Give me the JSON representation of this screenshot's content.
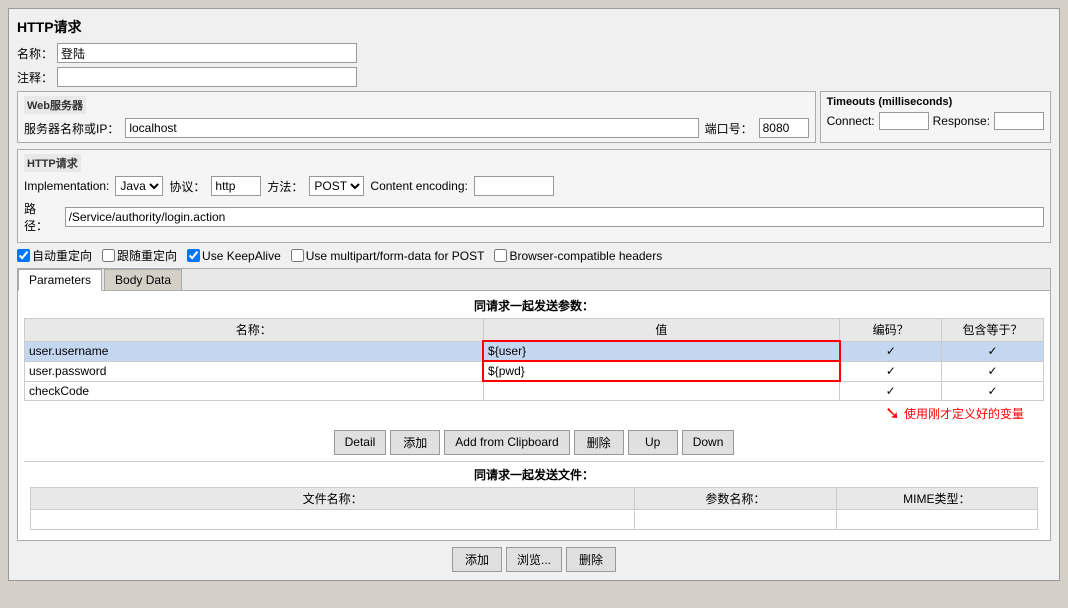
{
  "page": {
    "title": "HTTP请求"
  },
  "form": {
    "name_label": "名称：",
    "name_value": "登陆",
    "comment_label": "注释：",
    "comment_value": ""
  },
  "web_server": {
    "section_label": "Web服务器",
    "server_label": "服务器名称或IP：",
    "server_value": "localhost",
    "port_label": "端口号：",
    "port_value": "8080"
  },
  "timeouts": {
    "section_label": "Timeouts (milliseconds)",
    "connect_label": "Connect:",
    "connect_value": "",
    "response_label": "Response:",
    "response_value": ""
  },
  "http_section": {
    "section_label": "HTTP请求",
    "impl_label": "Implementation:",
    "impl_value": "Java",
    "protocol_label": "协议：",
    "protocol_value": "http",
    "method_label": "方法：",
    "method_value": "POST",
    "encoding_label": "Content encoding:",
    "encoding_value": "",
    "path_label": "路径：",
    "path_value": "/Service/authority/login.action"
  },
  "checkboxes": {
    "auto_redirect_label": "自动重定向",
    "auto_redirect_checked": true,
    "follow_redirect_label": "跟随重定向",
    "follow_redirect_checked": false,
    "keepalive_label": "Use KeepAlive",
    "keepalive_checked": true,
    "multipart_label": "Use multipart/form-data for POST",
    "multipart_checked": false,
    "browser_headers_label": "Browser-compatible headers",
    "browser_headers_checked": false
  },
  "tabs": {
    "parameters_label": "Parameters",
    "body_data_label": "Body Data",
    "active_tab": "parameters"
  },
  "params_section": {
    "title": "同请求一起发送参数：",
    "col_name": "名称：",
    "col_value": "值",
    "col_encode": "编码？",
    "col_include": "包含等于？",
    "rows": [
      {
        "name": "user.username",
        "value": "${user}",
        "encode": true,
        "include": true,
        "selected": true
      },
      {
        "name": "user.password",
        "value": "${pwd}",
        "encode": true,
        "include": true,
        "selected": false
      },
      {
        "name": "checkCode",
        "value": "",
        "encode": true,
        "include": true,
        "selected": false
      }
    ]
  },
  "annotation": {
    "text": "使用刚才定义好的变量"
  },
  "action_buttons": {
    "detail": "Detail",
    "add": "添加",
    "add_from_clipboard": "Add from Clipboard",
    "delete": "删除",
    "up": "Up",
    "down": "Down"
  },
  "files_section": {
    "title": "同请求一起发送文件：",
    "col_filename": "文件名称：",
    "col_param_name": "参数名称：",
    "col_mime": "MIME类型："
  },
  "bottom_buttons": {
    "add": "添加",
    "browse": "浏览...",
    "delete": "删除"
  }
}
